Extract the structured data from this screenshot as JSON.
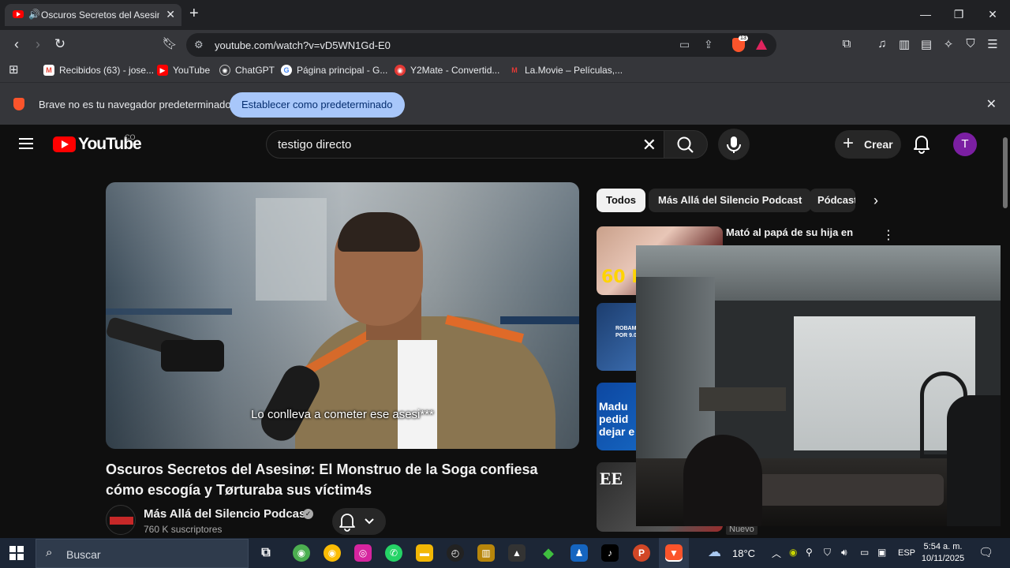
{
  "browser": {
    "tab_title": "Oscuros Secretos del Asesinø: El Monstruo de la Soga confiesa cómo escogía y Tørturaba sus víctim4s",
    "tab_visible_title": "Oscuros Secretos del Asesinø",
    "url": "youtube.com/watch?v=vD5WN1Gd-E0",
    "shield_count": "13",
    "bookmarks": [
      {
        "label": "Recibidos (63) - jose...",
        "icon": "gmail-icon",
        "color": "#ea4335"
      },
      {
        "label": "YouTube",
        "icon": "youtube-icon",
        "color": "#ff0000"
      },
      {
        "label": "ChatGPT",
        "icon": "chatgpt-icon",
        "color": "#ffffff"
      },
      {
        "label": "Página principal - G...",
        "icon": "google-icon",
        "color": "#4285f4"
      },
      {
        "label": "Y2Mate - Convertid...",
        "icon": "y2mate-icon",
        "color": "#e53935"
      },
      {
        "label": "La.Movie – Películas,...",
        "icon": "lamovie-icon",
        "color": "#c62828"
      }
    ],
    "infobar": {
      "message": "Brave no es tu navegador predeterminado",
      "button": "Establecer como predeterminado"
    }
  },
  "youtube": {
    "wordmark": "YouTube",
    "country": "CO",
    "search_value": "testigo directo",
    "create_label": "Crear",
    "avatar_letter": "T",
    "video": {
      "caption": "Lo conlleva a cometer ese asesi***",
      "title": "Oscuros Secretos del Asesinø: El Monstruo de la Soga confiesa cómo escogía y Tørturaba sus víctim4s",
      "channel": "Más Allá del Silencio Podcast",
      "subscribers": "760 K suscriptores"
    },
    "chips": [
      "Todos",
      "Más Allá del Silencio Podcast",
      "Pódcasts"
    ],
    "recommendations": [
      {
        "title": "Mató al papá de su hija en",
        "thumb_text": "60 PU",
        "thumb_color": "#b71c1c"
      },
      {
        "title": "",
        "thumb_text": "ROBAMO POR 9.0",
        "thumb_color": "#1565c0"
      },
      {
        "title": "",
        "thumb_text": "Madu pedid dejar e",
        "thumb_color": "#0d47a1"
      },
      {
        "title": "",
        "thumb_text": "EE",
        "thumb_color": "#222222"
      }
    ],
    "badge_new": "Nuevo"
  },
  "taskbar": {
    "search_placeholder": "Buscar",
    "weather": "18°C",
    "language": "ESP",
    "time": "5:54 a. m.",
    "date": "10/11/2025",
    "apps": [
      {
        "name": "task-view-icon",
        "color": "#1c2636"
      },
      {
        "name": "chrome-canary-icon",
        "color": "#4caf50"
      },
      {
        "name": "chrome-icon",
        "color": "#fbbc04"
      },
      {
        "name": "instagram-icon",
        "color": "#d6249f"
      },
      {
        "name": "whatsapp-icon",
        "color": "#25d366"
      },
      {
        "name": "file-explorer-icon",
        "color": "#f2b705"
      },
      {
        "name": "speedtest-icon",
        "color": "#222222"
      },
      {
        "name": "winrar-icon",
        "color": "#b8860b"
      },
      {
        "name": "inkscape-icon",
        "color": "#333333"
      },
      {
        "name": "sims-icon",
        "color": "#3fbf3f"
      },
      {
        "name": "app-blue-icon",
        "color": "#1565c0"
      },
      {
        "name": "tiktok-icon",
        "color": "#000000"
      },
      {
        "name": "powerpoint-icon",
        "color": "#d24726"
      },
      {
        "name": "brave-icon",
        "color": "#fb542b"
      }
    ]
  }
}
